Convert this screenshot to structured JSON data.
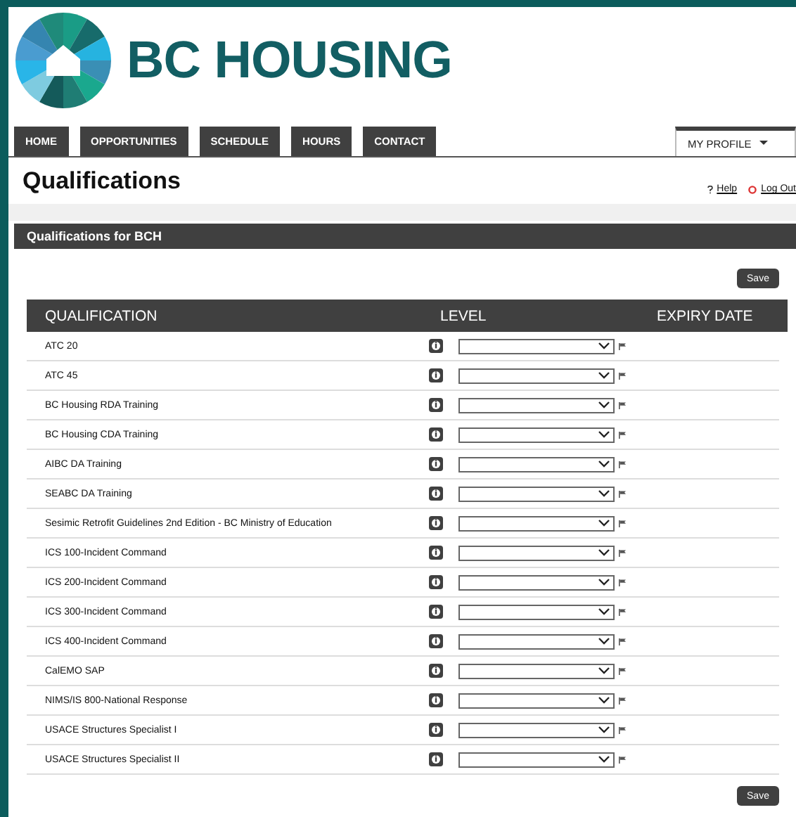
{
  "brand": {
    "name": "BC HOUSING"
  },
  "nav": {
    "tabs": [
      {
        "label": "HOME",
        "selected": false
      },
      {
        "label": "OPPORTUNITIES",
        "selected": false
      },
      {
        "label": "SCHEDULE",
        "selected": false
      },
      {
        "label": "HOURS",
        "selected": false
      },
      {
        "label": "CONTACT",
        "selected": false
      }
    ],
    "profile_menu": {
      "label": "MY PROFILE"
    }
  },
  "page": {
    "title": "Qualifications",
    "help": "Help",
    "logout": "Log Out"
  },
  "panel": {
    "title": "Qualifications for BCH",
    "save_top": "Save",
    "save_bottom": "Save"
  },
  "table": {
    "columns": [
      "QUALIFICATION",
      "LEVEL",
      "EXPIRY DATE"
    ],
    "rows": [
      {
        "name": "ATC 20"
      },
      {
        "name": "ATC 45"
      },
      {
        "name": "BC Housing RDA Training"
      },
      {
        "name": "BC Housing CDA Training"
      },
      {
        "name": "AIBC DA Training"
      },
      {
        "name": "SEABC DA Training"
      },
      {
        "name": "Sesimic Retrofit Guidelines 2nd Edition - BC Ministry of Education"
      },
      {
        "name": "ICS 100-Incident Command"
      },
      {
        "name": "ICS 200-Incident Command"
      },
      {
        "name": "ICS 300-Incident Command"
      },
      {
        "name": "ICS 400-Incident Command"
      },
      {
        "name": "CalEMO SAP"
      },
      {
        "name": "NIMS/IS 800-National Response"
      },
      {
        "name": "USACE Structures Specialist I"
      },
      {
        "name": "USACE Structures Specialist II"
      }
    ]
  }
}
